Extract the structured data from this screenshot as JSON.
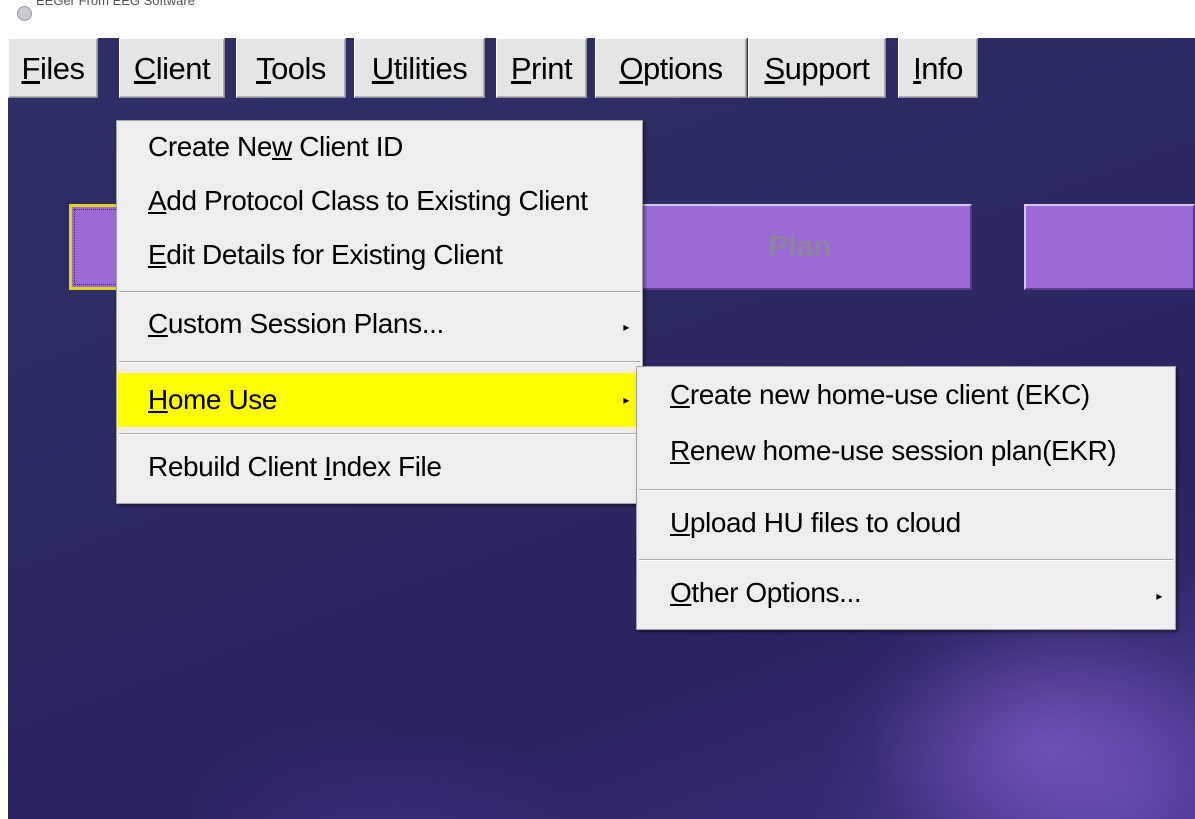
{
  "window": {
    "title": "EEGer From EEG Software"
  },
  "menubar": {
    "items": [
      {
        "pre": "",
        "key": "F",
        "post": "iles"
      },
      {
        "pre": "",
        "key": "C",
        "post": "lient"
      },
      {
        "pre": "",
        "key": "T",
        "post": "ools"
      },
      {
        "pre": "",
        "key": "U",
        "post": "tilities"
      },
      {
        "pre": "",
        "key": "P",
        "post": "rint"
      },
      {
        "pre": "",
        "key": "O",
        "post": "ptions"
      },
      {
        "pre": "",
        "key": "S",
        "post": "upport"
      },
      {
        "pre": "",
        "key": "I",
        "post": "nfo"
      }
    ]
  },
  "buttons": {
    "left_label": "",
    "plan_label": "Plan",
    "right_label": ""
  },
  "client_menu": {
    "items": [
      {
        "pre": "Create Ne",
        "key": "w",
        "post": " Client ID"
      },
      {
        "pre": "",
        "key": "A",
        "post": "dd Protocol Class to Existing Client"
      },
      {
        "pre": "",
        "key": "E",
        "post": "dit Details for Existing Client"
      },
      {
        "pre": "",
        "key": "C",
        "post": "ustom Session Plans..."
      },
      {
        "pre": "",
        "key": "H",
        "post": "ome Use"
      },
      {
        "pre": "Rebuild Client ",
        "key": "I",
        "post": "ndex File"
      }
    ]
  },
  "home_use_menu": {
    "items": [
      {
        "pre": "",
        "key": "C",
        "post": "reate new home-use client (EKC)"
      },
      {
        "pre": "",
        "key": "R",
        "post": "enew home-use session plan(EKR)"
      },
      {
        "pre": "",
        "key": "U",
        "post": "pload HU files to cloud"
      },
      {
        "pre": "",
        "key": "O",
        "post": "ther Options..."
      }
    ]
  },
  "icons": {
    "submenu_arrow": "▸"
  },
  "colors": {
    "highlight": "#ffff00",
    "button_purple": "#9b6ad6",
    "desktop": "#2c2a63"
  }
}
